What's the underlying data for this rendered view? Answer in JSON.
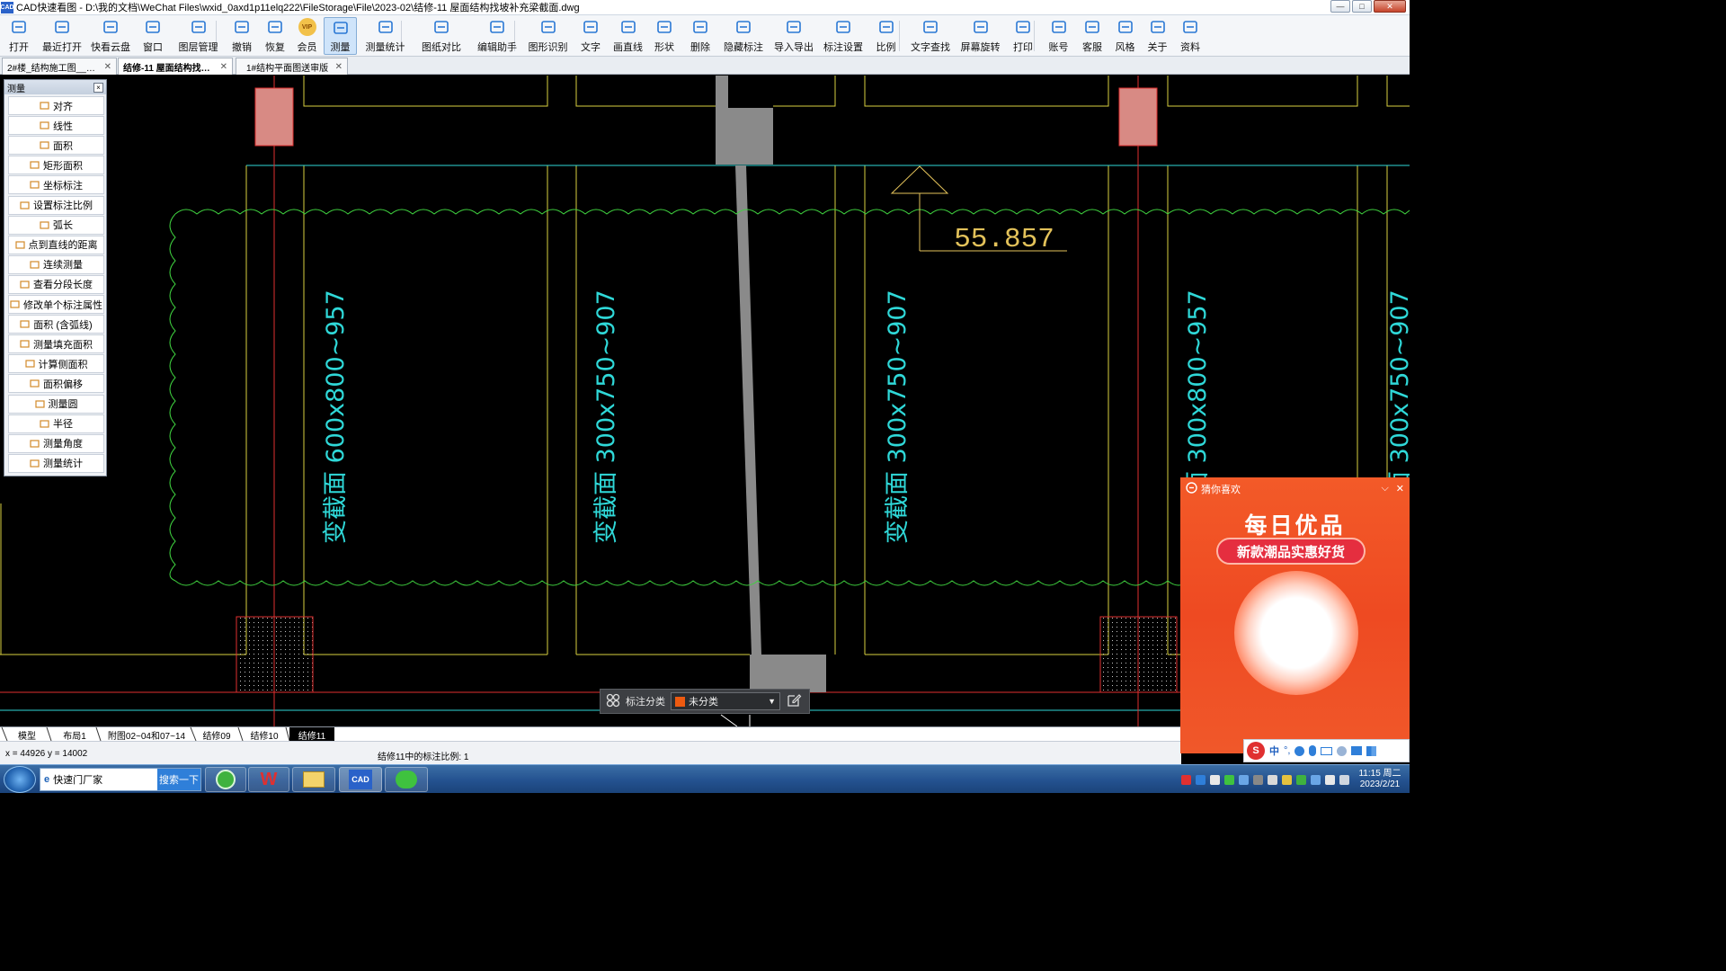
{
  "window": {
    "title": "CAD快速看图 - D:\\我的文档\\WeChat Files\\wxid_0axd1p11elq222\\FileStorage\\File\\2023-02\\结修-11 屋面结构找坡补充梁截面.dwg",
    "icon": "CAD",
    "controls": {
      "minimize": "—",
      "maximize": "□",
      "close": "✕"
    }
  },
  "toolbar": [
    {
      "label": "打开",
      "icon": "open-folder-icon"
    },
    {
      "label": "最近打开",
      "icon": "history-icon"
    },
    {
      "label": "快看云盘",
      "icon": "cloud-icon"
    },
    {
      "label": "窗口",
      "icon": "window-icon"
    },
    {
      "label": "图层管理",
      "icon": "layers-icon"
    },
    {
      "label": "撤销",
      "icon": "undo-icon"
    },
    {
      "label": "恢复",
      "icon": "redo-icon"
    },
    {
      "label": "会员",
      "icon": "vip-icon",
      "badge": "VIP"
    },
    {
      "label": "测量",
      "icon": "measure-icon"
    },
    {
      "label": "测量统计",
      "icon": "measure-stats-icon"
    },
    {
      "label": "图纸对比",
      "icon": "compare-icon"
    },
    {
      "label": "编辑助手",
      "icon": "edit-assistant-icon"
    },
    {
      "label": "图形识别",
      "icon": "shape-recognize-icon"
    },
    {
      "label": "文字",
      "icon": "text-icon"
    },
    {
      "label": "画直线",
      "icon": "line-icon"
    },
    {
      "label": "形状",
      "icon": "shape-icon"
    },
    {
      "label": "删除",
      "icon": "eraser-icon"
    },
    {
      "label": "隐藏标注",
      "icon": "hide-annotation-icon"
    },
    {
      "label": "导入导出",
      "icon": "import-export-icon"
    },
    {
      "label": "标注设置",
      "icon": "annotation-settings-icon"
    },
    {
      "label": "比例",
      "icon": "scale-icon"
    },
    {
      "label": "文字查找",
      "icon": "text-search-icon"
    },
    {
      "label": "屏幕旋转",
      "icon": "rotate-screen-icon"
    },
    {
      "label": "打印",
      "icon": "print-icon"
    },
    {
      "label": "账号",
      "icon": "account-icon"
    },
    {
      "label": "客服",
      "icon": "headset-icon"
    },
    {
      "label": "风格",
      "icon": "style-icon"
    },
    {
      "label": "关于",
      "icon": "info-icon"
    },
    {
      "label": "资料",
      "icon": "docs-icon"
    }
  ],
  "doc_tabs": [
    {
      "label": "2#楼_结构施工图__20…",
      "close": "✕"
    },
    {
      "label": "结修-11  屋面结构找…",
      "close": "✕"
    },
    {
      "label": "1#结构平面图送审版",
      "close": "✕"
    }
  ],
  "measure_panel": {
    "title": "测量",
    "close": "×",
    "items": [
      "对齐",
      "线性",
      "面积",
      "矩形面积",
      "坐标标注",
      "设置标注比例",
      "弧长",
      "点到直线的距离",
      "连续测量",
      "查看分段长度",
      "修改单个标注属性",
      "面积 (含弧线)",
      "测量填充面积",
      "计算侧面积",
      "面积偏移",
      "测量圆",
      "半径",
      "测量角度",
      "测量统计"
    ]
  },
  "drawing": {
    "elevation": "55.857",
    "labels": [
      "变截面 600x800~957",
      "变截面 300x750~907",
      "变截面 300x750~907",
      "变截面 300x800~957",
      "变截面 300x750~907"
    ]
  },
  "layer_bar": {
    "label": "标注分类",
    "value": "未分类",
    "swatch": "#ee5a10"
  },
  "layout_tabs": [
    "模型",
    "布局1",
    "附图02~04和07~14",
    "结修09",
    "结修10",
    "结修11"
  ],
  "status": {
    "coords": "x = 44926  y = 14002",
    "scale": "结修11中的标注比例: 1"
  },
  "ad": {
    "header": "猜你喜欢",
    "title": "每日优品",
    "subtitle": "新款潮品实惠好货",
    "controls": {
      "collapse": "⌵",
      "close": "✕"
    }
  },
  "ime": {
    "lang": "中",
    "punct": "°,",
    "logo": "S"
  },
  "taskbar": {
    "search_text": "快速门厂家",
    "search_button": "搜索一下",
    "app_cad": "CAD"
  },
  "clock": {
    "time": "11:15 周二",
    "date": "2023/2/21"
  },
  "colors": {
    "cyan": "#2fd8d8",
    "yellow": "#d8cf3f",
    "red": "#e03030",
    "green": "#3fd23f",
    "gray": "#8a8a8a",
    "annotation": "#e3c25a"
  }
}
